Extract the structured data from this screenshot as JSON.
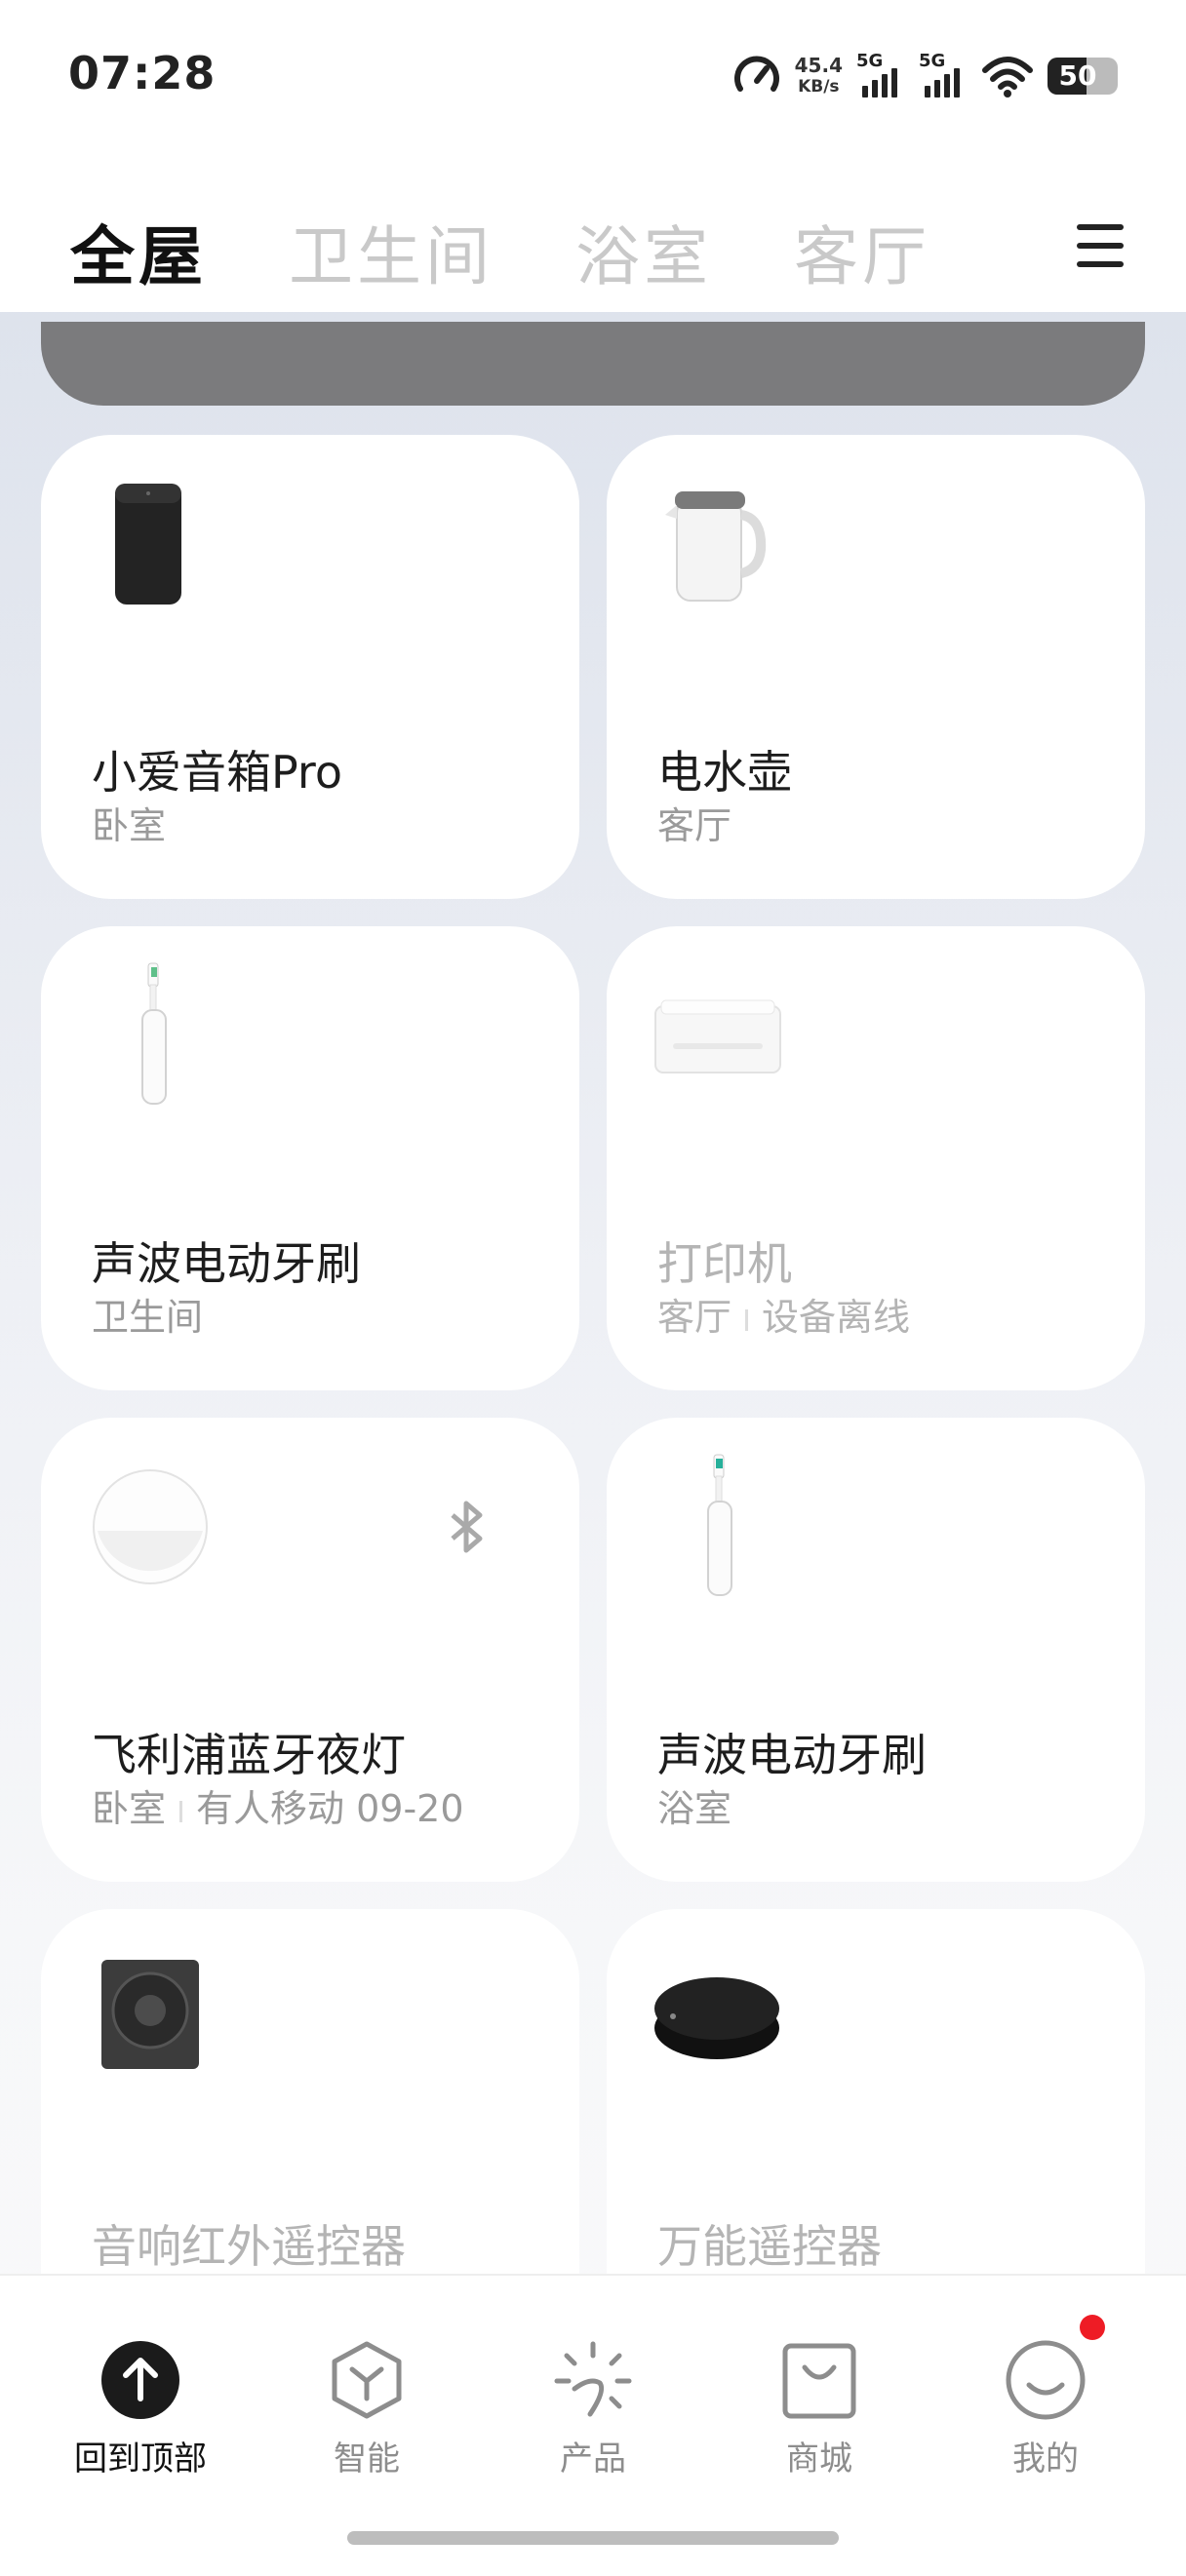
{
  "status_bar": {
    "time": "07:28",
    "net_speed_value": "45.4",
    "net_speed_unit": "KB/s",
    "signal_1": "5G",
    "signal_2": "5G",
    "battery": "50"
  },
  "tabs": [
    {
      "label": "全屋",
      "active": true
    },
    {
      "label": "卫生间"
    },
    {
      "label": "浴室"
    },
    {
      "label": "客厅"
    }
  ],
  "devices": [
    {
      "name": "小爱音箱Pro",
      "room": "卧室",
      "icon": "smart-speaker"
    },
    {
      "name": "电水壶",
      "room": "客厅",
      "icon": "electric-kettle"
    },
    {
      "name": "声波电动牙刷",
      "room": "卫生间",
      "icon": "toothbrush"
    },
    {
      "name": "打印机",
      "room": "客厅",
      "status": "设备离线",
      "offline": true,
      "icon": "printer"
    },
    {
      "name": "飞利浦蓝牙夜灯",
      "room": "卧室",
      "status": "有人移动 09-20",
      "icon": "night-light",
      "badge": "bluetooth-icon"
    },
    {
      "name": "声波电动牙刷",
      "room": "浴室",
      "icon": "toothbrush"
    },
    {
      "name": "音响红外遥控器",
      "room": "",
      "offline": true,
      "icon": "speaker-remote"
    },
    {
      "name": "万能遥控器",
      "room": "",
      "offline": true,
      "icon": "universal-remote"
    }
  ],
  "bottom_nav": [
    {
      "label": "回到顶部",
      "icon": "arrow-up-icon",
      "active": true
    },
    {
      "label": "智能",
      "icon": "cube-icon"
    },
    {
      "label": "产品",
      "icon": "sparkle-icon"
    },
    {
      "label": "商城",
      "icon": "bag-icon"
    },
    {
      "label": "我的",
      "icon": "smiley-icon",
      "notification": true
    }
  ],
  "colors": {
    "accent": "#111111",
    "inactive_tab": "#c9c9c9",
    "badge_red": "#ee1c25",
    "banner": "#7b7b7d"
  }
}
